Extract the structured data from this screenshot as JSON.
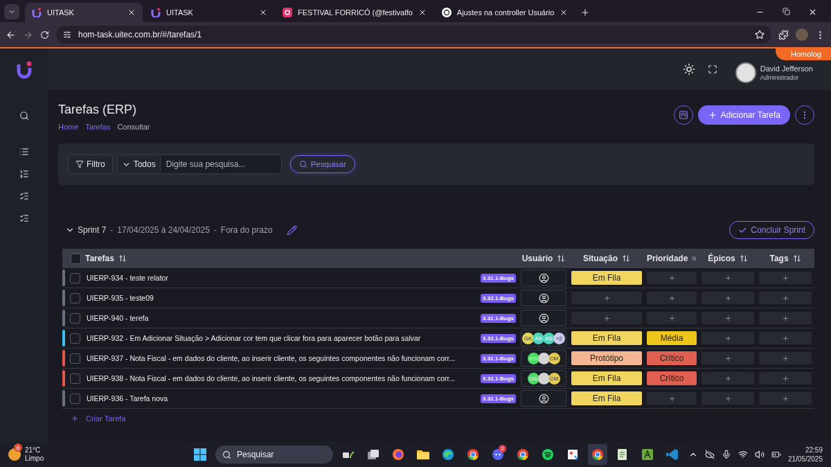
{
  "browser": {
    "tabs": [
      {
        "title": "UITASK",
        "kind": "app",
        "selected": true
      },
      {
        "title": "UITASK",
        "kind": "app",
        "selected": false
      },
      {
        "title": "FESTIVAL FORRICÓ (@festivalfo",
        "kind": "instagram",
        "selected": false
      },
      {
        "title": "Ajustes na controller Usuário",
        "kind": "chat",
        "selected": false
      }
    ],
    "url": "hom-task.uitec.com.br/#/tarefas/1"
  },
  "header": {
    "environment": "Homolog",
    "user": {
      "name": "David Jefferson",
      "role": "Administrador"
    }
  },
  "sidebar": {
    "items": [
      {
        "kind": "search"
      },
      {
        "kind": "list"
      },
      {
        "kind": "ordered"
      },
      {
        "kind": "checks"
      },
      {
        "kind": "checks"
      }
    ]
  },
  "page": {
    "title": "Tarefas (ERP)",
    "breadcrumb": [
      {
        "label": "Home",
        "kind": "link"
      },
      {
        "label": "Tarefas",
        "kind": "link"
      },
      {
        "label": "Consultar",
        "kind": "current"
      }
    ],
    "add_button": "Adicionar Tarefa"
  },
  "filter": {
    "filter_button": "Filtro",
    "scope": "Todos",
    "placeholder": "Digite sua pesquisa...",
    "search_button": "Pesquisar"
  },
  "sprint": {
    "name": "Sprint 7",
    "dates": "17/04/2025 à 24/04/2025",
    "status": "Fora do prazo",
    "separators": [
      "-",
      "-"
    ],
    "expanded": true,
    "action": "Concluir Sprint"
  },
  "table": {
    "all_checked": false,
    "columns": [
      {
        "label": "Tarefas"
      },
      {
        "label": "Usuário"
      },
      {
        "label": "Situação"
      },
      {
        "label": "Prioridade"
      },
      {
        "label": "Épicos"
      },
      {
        "label": "Tags"
      }
    ],
    "rows": [
      {
        "title": "UIERP-934 - teste relator",
        "color": "#6b7080",
        "checked": false,
        "version": "3.32.1-Bugs",
        "users": [],
        "status": {
          "label": "Em Fila",
          "color": "#f0d55e"
        }
      },
      {
        "title": "UIERP-935 - teste09",
        "color": "#6b7080",
        "checked": false,
        "version": "3.32.1-Bugs",
        "users": []
      },
      {
        "title": "UIERP-940 - terefa",
        "color": "#6b7080",
        "checked": false,
        "version": "3.32.1-Bugs",
        "users": []
      },
      {
        "title": "UIERP-932 - Em Adicionar Situação > Adicionar cor tem que clicar fora para aparecer botão para salvar",
        "color": "#3fc1f0",
        "checked": false,
        "version": "3.32.1-Bugs",
        "users": [
          {
            "initials": "GK",
            "color": "#e3d55c"
          },
          {
            "initials": "AS",
            "color": "#4fd6bd"
          },
          {
            "initials": "AS",
            "color": "#4fd6bd"
          },
          {
            "initials": "+2",
            "color": "#c9c9ef"
          }
        ],
        "status": {
          "label": "Em Fila",
          "color": "#f0d55e"
        },
        "priority": {
          "label": "Média",
          "color": "#eec51b"
        }
      },
      {
        "title": "UIERP-937 - Nota Fiscal - em dados do cliente, ao inserir cliente, os seguintes componentes não funcionam corr...",
        "color": "#e5564b",
        "checked": false,
        "version": "3.32.1-Bugs",
        "users": [
          {
            "initials": "GS",
            "color": "#4cd964"
          },
          {
            "color": "#d4d4d4"
          },
          {
            "initials": "CM",
            "color": "#e6cb52"
          }
        ],
        "status": {
          "label": "Protótipo",
          "color": "#f5b694"
        },
        "priority": {
          "label": "Crítico",
          "color": "#e05f50"
        }
      },
      {
        "title": "UIERP-938 - Nota Fiscal - em dados do cliente, ao inserir cliente, os seguintes componentes não funcionam corr...",
        "color": "#e5564b",
        "checked": false,
        "version": "3.32.1-Bugs",
        "users": [
          {
            "initials": "GS",
            "color": "#4cd964"
          },
          {
            "color": "#d4d4d4"
          },
          {
            "initials": "CM",
            "color": "#e6cb52"
          }
        ],
        "status": {
          "label": "Em Fila",
          "color": "#f0d55e"
        },
        "priority": {
          "label": "Crítico",
          "color": "#e05f50"
        }
      },
      {
        "title": "UIERP-936 - Tarefa nova",
        "color": "#6b7080",
        "checked": false,
        "version": "3.32.1-Bugs",
        "users": [],
        "status": {
          "label": "Em Fila",
          "color": "#f0d55e"
        }
      }
    ],
    "add_label": "Criar Tarefa"
  },
  "taskbar": {
    "weather": {
      "badge": "6",
      "temperature": "21°C",
      "condition": "Limpo"
    },
    "search": "Pesquisar",
    "apps": [
      {
        "kind": "start"
      },
      {
        "kind": "widgets"
      },
      {
        "kind": "taskview"
      },
      {
        "kind": "firefox"
      },
      {
        "kind": "folder"
      },
      {
        "kind": "edge"
      },
      {
        "kind": "chrome"
      },
      {
        "kind": "discord",
        "badge": "2"
      },
      {
        "kind": "chrome"
      },
      {
        "kind": "spotify"
      },
      {
        "kind": "paint"
      },
      {
        "kind": "chrome",
        "selected": true
      },
      {
        "kind": "notepad"
      },
      {
        "kind": "translate"
      },
      {
        "kind": "vscode"
      }
    ],
    "time": "22:59",
    "date": "21/05/2025"
  }
}
